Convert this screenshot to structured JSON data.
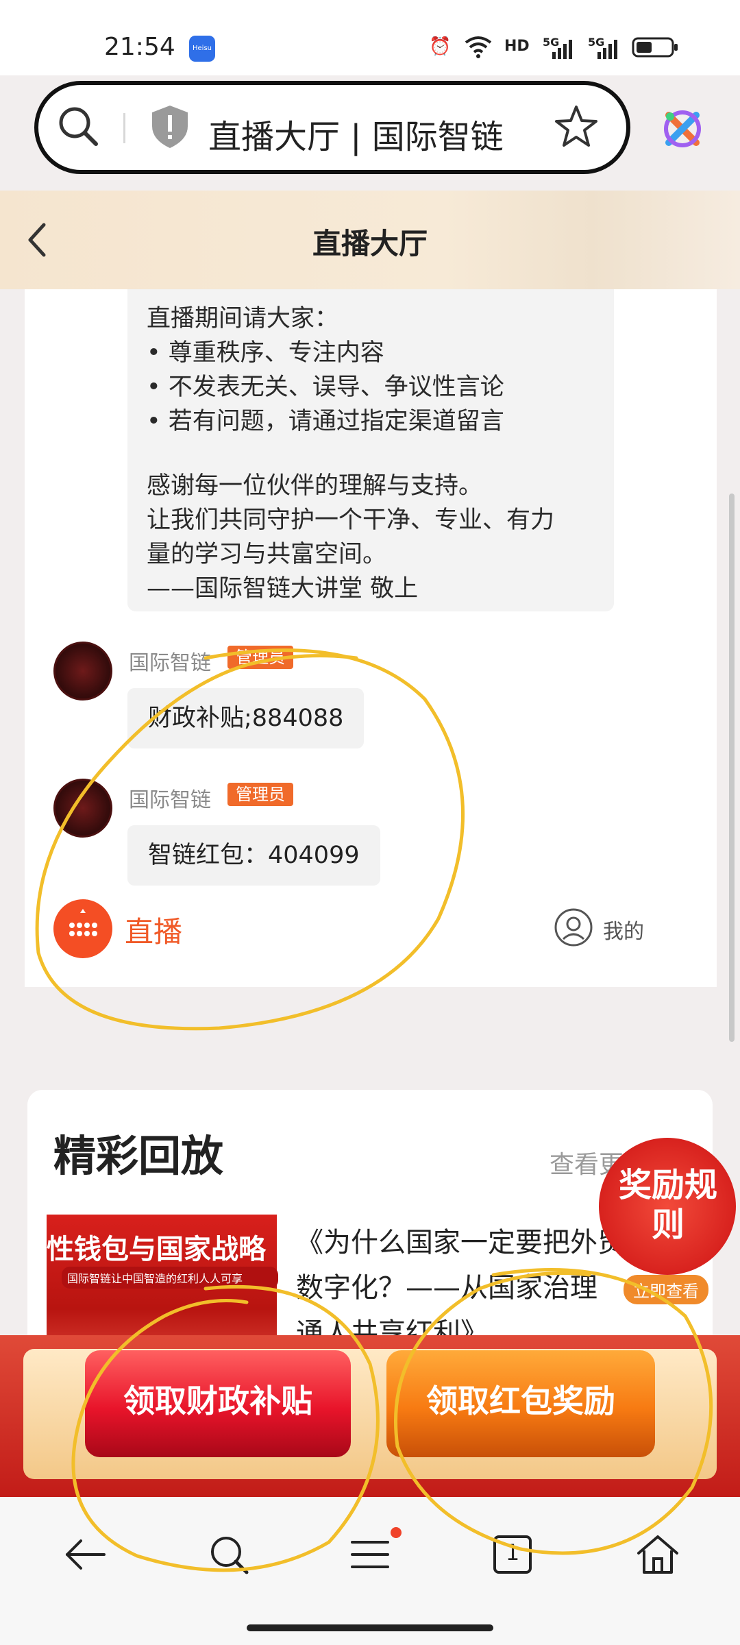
{
  "status_bar": {
    "time": "21:54",
    "app_badge": "Heisu",
    "hd_label": "HD",
    "signal1": "5G",
    "signal2": "5G"
  },
  "url_bar": {
    "title": "直播大厅 | 国际智链"
  },
  "header": {
    "title": "直播大厅"
  },
  "notice": {
    "lines": [
      "直播期间请大家：",
      "• 尊重秩序、专注内容",
      "• 不发表无关、误导、争议性言论",
      "• 若有问题，请通过指定渠道留言",
      "感谢每一位伙伴的理解与支持。",
      "让我们共同守护一个干净、专业、有力",
      "量的学习与共富空间。",
      "——国际智链大讲堂 敬上"
    ]
  },
  "messages": [
    {
      "sender": "国际智链",
      "badge": "管理员",
      "text": "财政补贴;884088"
    },
    {
      "sender": "国际智链",
      "badge": "管理员",
      "text": "智链红包：404099"
    }
  ],
  "live_bar": {
    "live_label": "直播",
    "mine_label": "我的"
  },
  "replay": {
    "title": "精彩回放",
    "more": "查看更多 >",
    "thumb_text": "性钱包与国家战略",
    "thumb_sub": "国际智链让中国智造的红利人人可享",
    "title_lines": [
      "《为什么国家一定要把外贸",
      "数字化？——从国家治理",
      "通人共享红利》"
    ]
  },
  "reward": {
    "text": "奖励规则",
    "sub": "立即查看"
  },
  "claim": {
    "subsidy_label": "领取财政补贴",
    "redpacket_label": "领取红包奖励"
  },
  "bottom_nav": {
    "tab_count": "1"
  },
  "colors": {
    "accent": "#f05a28",
    "badge": "#f06a2a",
    "annotation": "#f2be2a"
  }
}
